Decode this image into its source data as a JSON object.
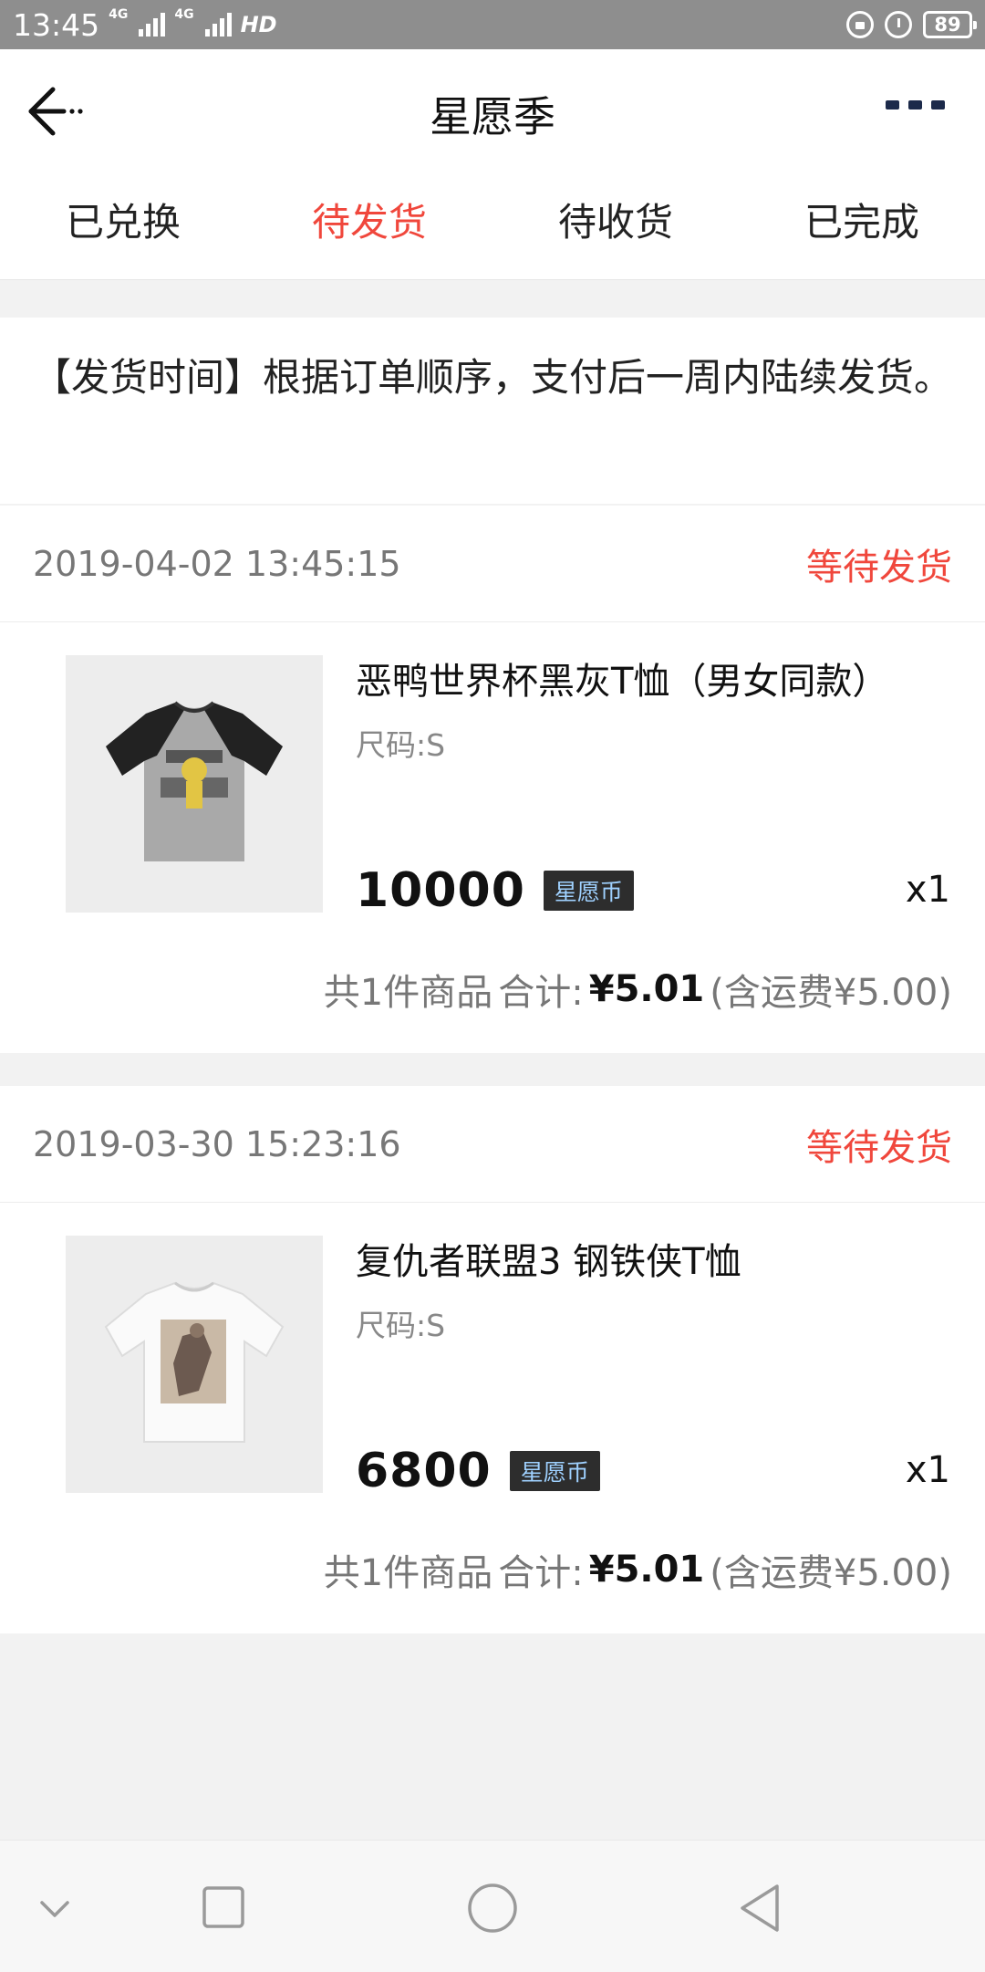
{
  "status_bar": {
    "time": "13:45",
    "network_1": "4G",
    "network_2": "4G",
    "hd": "HD",
    "battery": "89"
  },
  "header": {
    "title": "星愿季"
  },
  "tabs": [
    {
      "label": "已兑换",
      "active": false
    },
    {
      "label": "待发货",
      "active": true
    },
    {
      "label": "待收货",
      "active": false
    },
    {
      "label": "已完成",
      "active": false
    }
  ],
  "notice": "【发货时间】根据订单顺序，支付后一周内陆续发货。",
  "orders": [
    {
      "time": "2019-04-02 13:45:15",
      "status": "等待发货",
      "product_name": "恶鸭世界杯黑灰T恤（男女同款）",
      "size": "尺码:S",
      "price": "10000",
      "currency": "星愿币",
      "quantity": "x1",
      "count_text": "共1件商品",
      "total_label": "合计:",
      "total": "¥5.01",
      "shipping": "(含运费¥5.00)"
    },
    {
      "time": "2019-03-30 15:23:16",
      "status": "等待发货",
      "product_name": "复仇者联盟3 钢铁侠T恤",
      "size": "尺码:S",
      "price": "6800",
      "currency": "星愿币",
      "quantity": "x1",
      "count_text": "共1件商品",
      "total_label": "合计:",
      "total": "¥5.01",
      "shipping": "(含运费¥5.00)"
    }
  ],
  "icons": {
    "back": "back-arrow-icon",
    "more": "more-dots-icon",
    "nav": [
      "chevron-down-icon",
      "square-icon",
      "circle-icon",
      "triangle-back-icon"
    ]
  },
  "colors": {
    "accent": "#f0473c",
    "status_bar": "#8e8e8e",
    "badge_bg": "#2d2d2d",
    "badge_text": "#9fd1ff"
  }
}
